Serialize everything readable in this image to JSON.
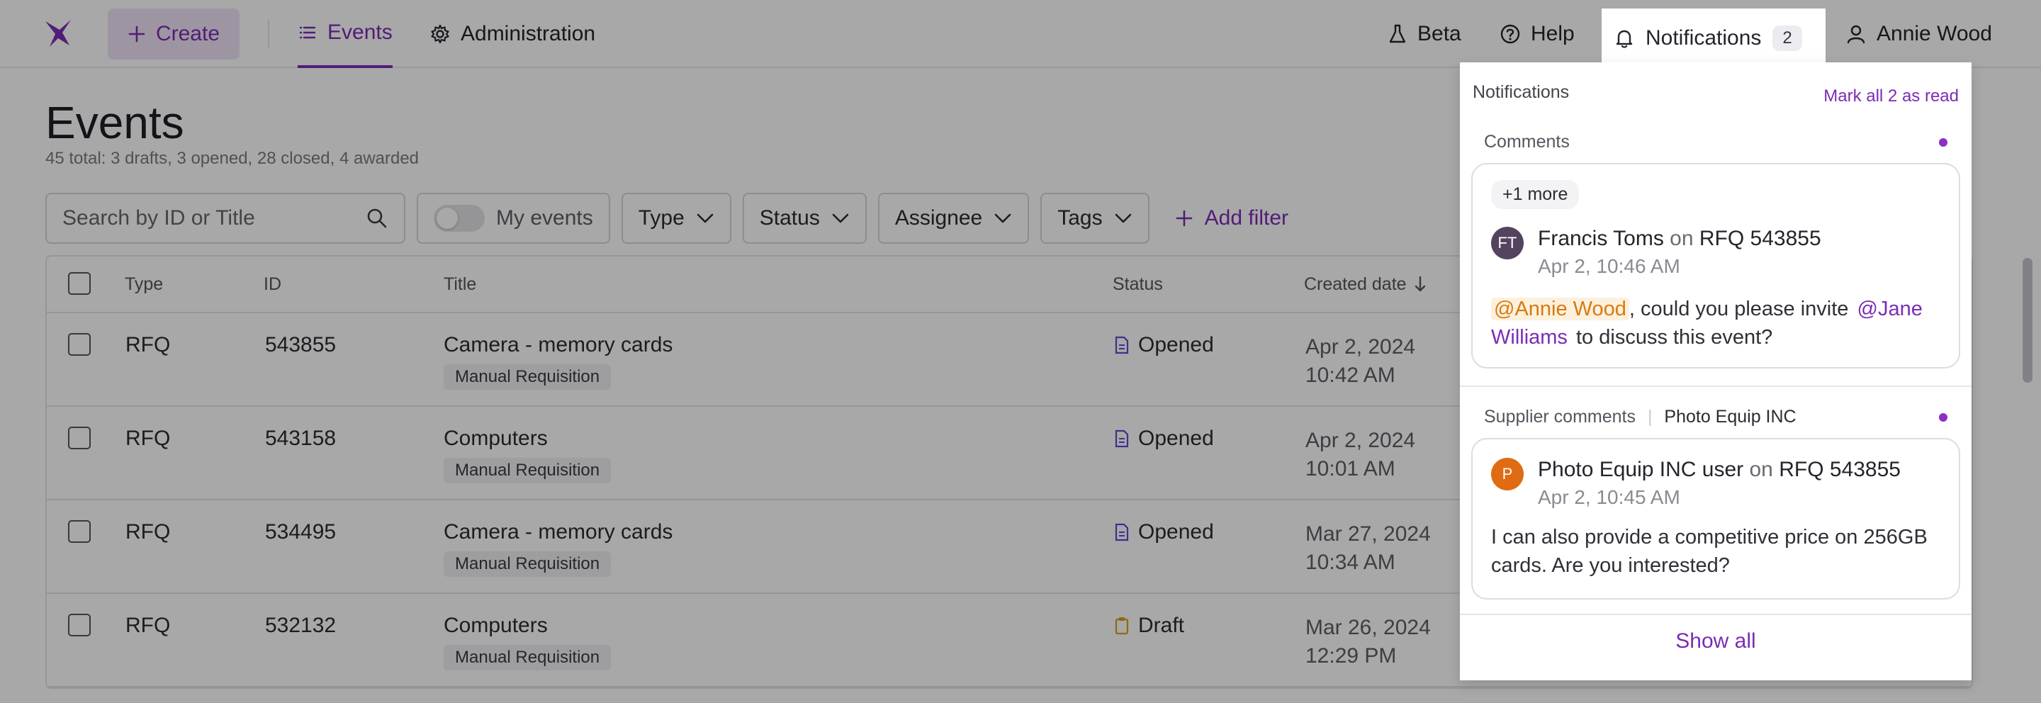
{
  "nav": {
    "create_label": "Create",
    "events_label": "Events",
    "admin_label": "Administration",
    "beta_label": "Beta",
    "help_label": "Help",
    "notifications_label": "Notifications",
    "notifications_count": "2",
    "user_name": "Annie Wood"
  },
  "page": {
    "title": "Events",
    "summary": "45 total: 3 drafts, 3 opened, 28 closed, 4 awarded"
  },
  "filters": {
    "search_placeholder": "Search by ID or Title",
    "my_events_label": "My events",
    "type_label": "Type",
    "status_label": "Status",
    "assignee_label": "Assignee",
    "tags_label": "Tags",
    "add_filter_label": "Add filter"
  },
  "table": {
    "columns": {
      "type": "Type",
      "id": "ID",
      "title": "Title",
      "status": "Status",
      "created": "Created date"
    },
    "rows": [
      {
        "type": "RFQ",
        "id": "543855",
        "title": "Camera - memory cards",
        "tag": "Manual Requisition",
        "status": "Opened",
        "date": "Apr 2, 2024",
        "time": "10:42 AM"
      },
      {
        "type": "RFQ",
        "id": "543158",
        "title": "Computers",
        "tag": "Manual Requisition",
        "status": "Opened",
        "date": "Apr 2, 2024",
        "time": "10:01 AM"
      },
      {
        "type": "RFQ",
        "id": "534495",
        "title": "Camera - memory cards",
        "tag": "Manual Requisition",
        "status": "Opened",
        "date": "Mar 27, 2024",
        "time": "10:34 AM"
      },
      {
        "type": "RFQ",
        "id": "532132",
        "title": "Computers",
        "tag": "Manual Requisition",
        "status": "Draft",
        "date": "Mar 26, 2024",
        "time": "12:29 PM"
      }
    ]
  },
  "notifications": {
    "title": "Notifications",
    "mark_all": "Mark all 2 as read",
    "comments_section": {
      "label": "Comments",
      "more": "+1 more",
      "avatar_initials": "FT",
      "author": "Francis Toms",
      "on_word": "on",
      "reference": "RFQ 543855",
      "time": "Apr 2, 10:46 AM",
      "mention_1": "@Annie Wood",
      "text_1": ", could you please invite",
      "mention_2": "@Jane Williams",
      "text_2": "to discuss this event?"
    },
    "supplier_section": {
      "label": "Supplier comments",
      "supplier": "Photo Equip INC",
      "avatar_initials": "P",
      "author": "Photo Equip INC user",
      "on_word": "on",
      "reference": "RFQ 543855",
      "time": "Apr 2, 10:45 AM",
      "text": "I can also provide a competitive price on 256GB cards. Are you interested?"
    },
    "show_all": "Show all"
  },
  "colors": {
    "accent": "#7b2cb4",
    "opened_icon": "#5b4bd6",
    "draft_icon": "#d6a21a",
    "avatar_ft": "#54435f",
    "avatar_p": "#e06b12"
  }
}
